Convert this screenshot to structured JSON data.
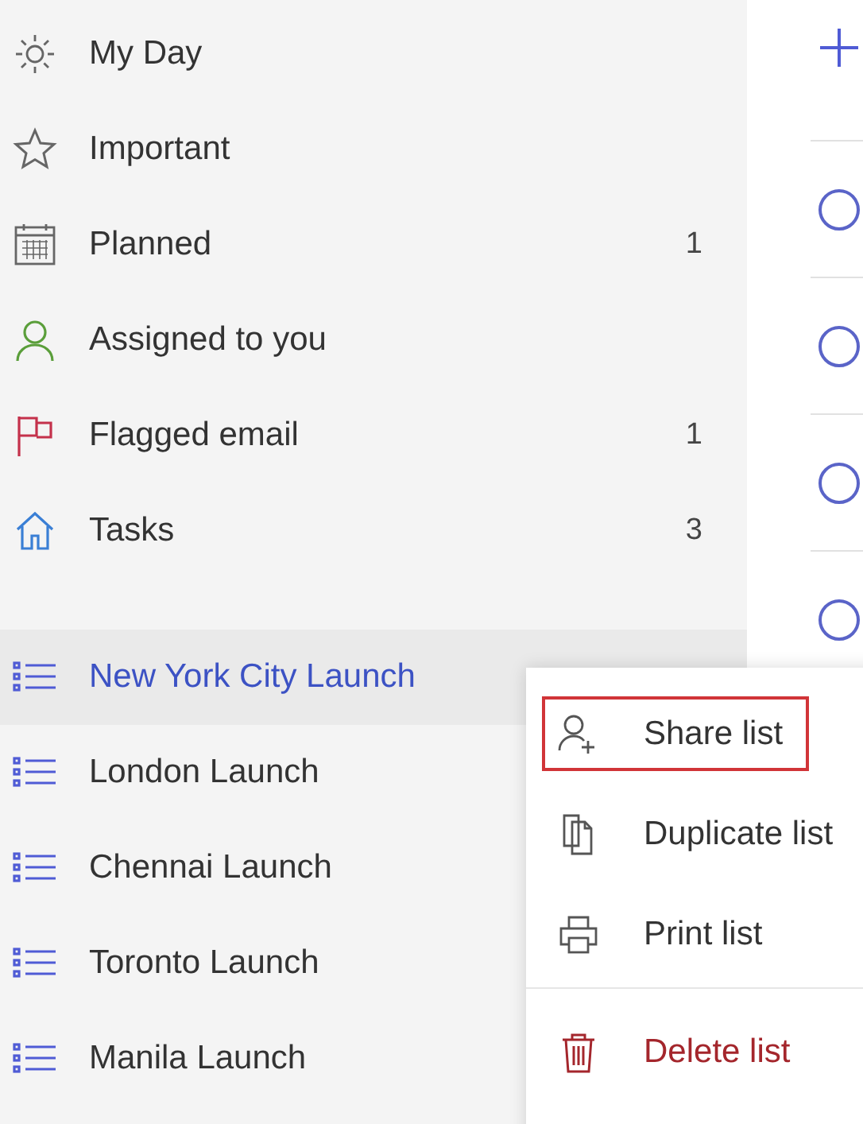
{
  "sidebar": {
    "smart_lists": [
      {
        "kind": "sun",
        "label": "My Day",
        "selected": false
      },
      {
        "kind": "star",
        "label": "Important",
        "selected": false
      },
      {
        "kind": "calendar",
        "label": "Planned",
        "count": "1",
        "selected": false
      },
      {
        "kind": "person",
        "label": "Assigned to you",
        "selected": false
      },
      {
        "kind": "flag",
        "label": "Flagged email",
        "count": "1",
        "selected": false
      },
      {
        "kind": "home",
        "label": "Tasks",
        "count": "3",
        "selected": false
      }
    ],
    "lists": [
      {
        "label": "New York City Launch",
        "selected": true
      },
      {
        "label": "London Launch",
        "selected": false
      },
      {
        "label": "Chennai Launch",
        "selected": false
      },
      {
        "label": "Toronto Launch",
        "selected": false
      },
      {
        "label": "Manila Launch",
        "selected": false
      }
    ]
  },
  "tasks": [
    {
      "checked": false
    },
    {
      "checked": false
    },
    {
      "checked": false
    },
    {
      "checked": false
    }
  ],
  "context_menu": {
    "items": [
      {
        "kind": "share",
        "label": "Share list",
        "highlighted": true,
        "danger": false
      },
      {
        "kind": "duplicate",
        "label": "Duplicate list",
        "highlighted": false,
        "danger": false
      },
      {
        "kind": "print",
        "label": "Print list",
        "highlighted": false,
        "danger": false,
        "divider_after": true
      },
      {
        "kind": "delete",
        "label": "Delete list",
        "highlighted": false,
        "danger": true
      }
    ]
  }
}
